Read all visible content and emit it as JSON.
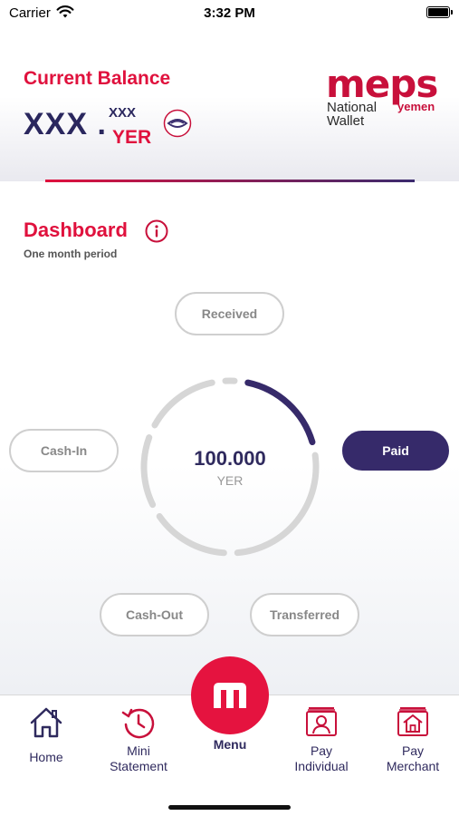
{
  "status_bar": {
    "carrier": "Carrier",
    "time": "3:32 PM",
    "battery_level": 1.0
  },
  "header": {
    "balance_title": "Current Balance",
    "balance_major": "XXX .",
    "balance_minor": "XXX",
    "balance_currency": "YER",
    "logo": {
      "brand": "meps",
      "country": "yemen",
      "line1": "National",
      "line2": "Wallet"
    }
  },
  "dashboard": {
    "title": "Dashboard",
    "subtitle": "One month period",
    "total_amount": "100.000",
    "total_currency": "YER",
    "filters": {
      "received": "Received",
      "cash_in": "Cash-In",
      "paid": "Paid",
      "cash_out": "Cash-Out",
      "transferred": "Transferred"
    },
    "selected_filter": "Paid",
    "highlight_fraction": 0.17
  },
  "bottom_nav": {
    "home": "Home",
    "mini_statement": [
      "Mini",
      "Statement"
    ],
    "menu": "Menu",
    "pay_individual": [
      "Pay",
      "Individual"
    ],
    "pay_merchant": [
      "Pay",
      "Merchant"
    ]
  },
  "colors": {
    "brand_red": "#e0113d",
    "navy": "#2f2a5e",
    "active_pill": "#362a6a",
    "ring_track": "#d6d6d6"
  }
}
